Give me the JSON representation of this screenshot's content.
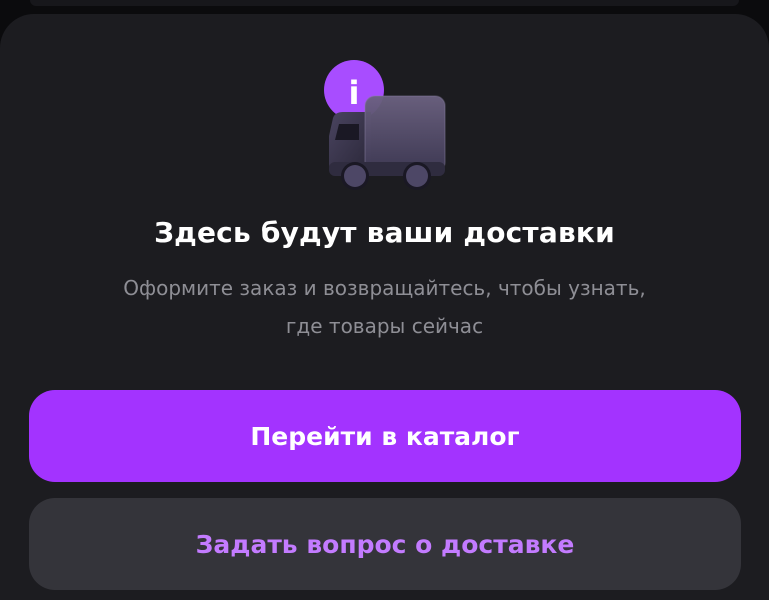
{
  "empty_state": {
    "title": "Здесь будут ваши доставки",
    "subtitle_line1": "Оформите заказ и возвращайтесь, чтобы узнать,",
    "subtitle_line2": "где товары сейчас",
    "icon": "delivery-truck-with-info-badge",
    "info_badge_glyph": "i"
  },
  "actions": {
    "primary_label": "Перейти в каталог",
    "secondary_label": "Задать вопрос о доставке"
  },
  "colors": {
    "background": "#0b0b0d",
    "card": "#1c1c20",
    "accent": "#a333ff",
    "accent_text": "#c37bff",
    "secondary_button": "#34343a",
    "muted_text": "#8e8e95"
  }
}
